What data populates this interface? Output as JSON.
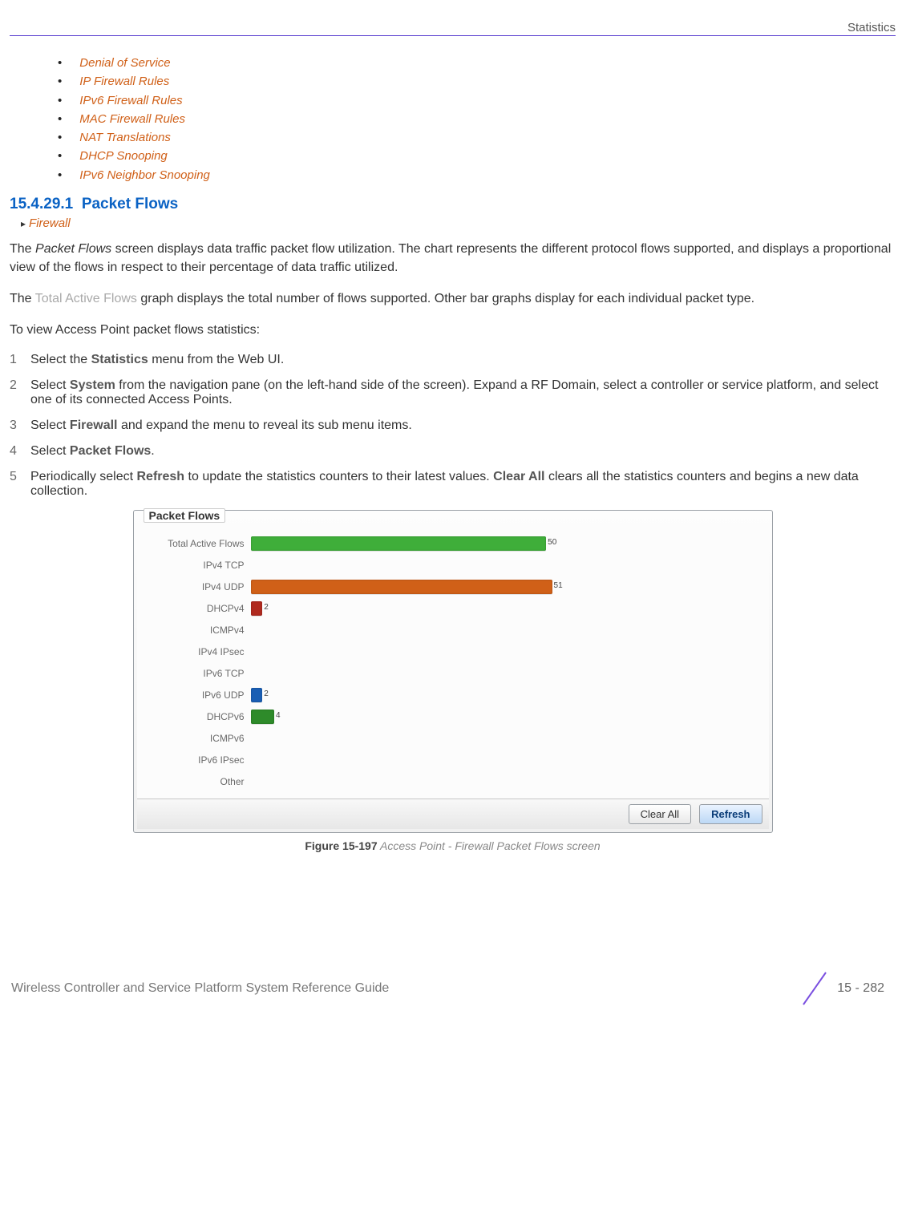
{
  "header": {
    "section": "Statistics"
  },
  "toc": {
    "items": [
      "Denial of Service",
      "IP Firewall Rules",
      "IPv6 Firewall Rules",
      "MAC Firewall Rules",
      "NAT Translations",
      "DHCP Snooping",
      "IPv6 Neighbor Snooping"
    ]
  },
  "heading": {
    "number": "15.4.29.1",
    "title": "Packet Flows"
  },
  "breadcrumb": {
    "label": "Firewall"
  },
  "para": {
    "p1a": "The ",
    "p1b": "Packet Flows",
    "p1c": " screen displays data traffic packet flow utilization. The chart represents the different protocol flows supported, and displays a proportional view of the flows in respect to their percentage of data traffic utilized.",
    "p2a": "The ",
    "p2b": "Total Active Flows",
    "p2c": " graph displays the total number of flows supported. Other bar graphs display for each individual packet type.",
    "p3": "To view Access Point packet flows statistics:"
  },
  "steps": [
    {
      "n": "1",
      "pre": "Select the ",
      "b1": "Statistics",
      "post": " menu from the Web UI."
    },
    {
      "n": "2",
      "pre": "Select ",
      "b1": "System",
      "post": " from the navigation pane (on the left-hand side of the screen). Expand a RF Domain, select a controller or service platform, and select one of its connected Access Points."
    },
    {
      "n": "3",
      "pre": "Select ",
      "b1": "Firewall",
      "post": " and expand the menu to reveal its sub menu items."
    },
    {
      "n": "4",
      "pre": "Select ",
      "b1": "Packet Flows",
      "post": "."
    },
    {
      "n": "5",
      "pre": "Periodically select ",
      "b1": "Refresh",
      "mid": " to update the statistics counters to their latest values. ",
      "b2": "Clear All",
      "post": " clears all the statistics counters and begins a new data collection."
    }
  ],
  "figure": {
    "panel_title": "Packet Flows",
    "buttons": {
      "clear": "Clear All",
      "refresh": "Refresh"
    },
    "caption_bold": "Figure 15-197",
    "caption_rest": "  Access Point - Firewall Packet Flows screen"
  },
  "chart_data": {
    "type": "bar",
    "title": "Packet Flows",
    "orientation": "horizontal",
    "xlim": [
      0,
      60
    ],
    "categories": [
      "Total Active Flows",
      "IPv4 TCP",
      "IPv4 UDP",
      "DHCPv4",
      "ICMPv4",
      "IPv4 IPsec",
      "IPv6 TCP",
      "IPv6 UDP",
      "DHCPv6",
      "ICMPv6",
      "IPv6 IPsec",
      "Other"
    ],
    "series": [
      {
        "name": "flows",
        "values": [
          50,
          0,
          51,
          2,
          0,
          0,
          0,
          2,
          4,
          0,
          0,
          0
        ],
        "colors": [
          "#3fae3a",
          "#3fae3a",
          "#d06018",
          "#b02a1f",
          "#b02a1f",
          "#b02a1f",
          "#b02a1f",
          "#1a5fb4",
          "#2e8b2a",
          "#b02a1f",
          "#b02a1f",
          "#b02a1f"
        ]
      }
    ]
  },
  "footer": {
    "text": "Wireless Controller and Service Platform System Reference Guide",
    "page": "15 - 282"
  }
}
